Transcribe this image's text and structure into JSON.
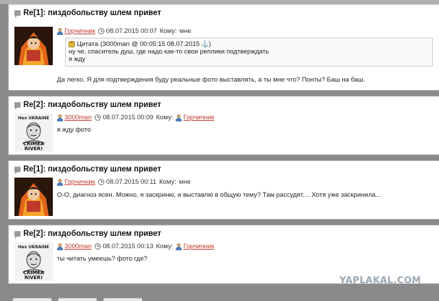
{
  "posts": [
    {
      "title": "Re[1]: пиздобольству шлем привет",
      "author": "Горчичник",
      "time": "08.07.2015 00:07",
      "to_label": "Кому:",
      "to": "мне",
      "quote": {
        "label": "Цитата",
        "source": "(3000man @ 00:05:15 08.07.2015",
        "close": ")",
        "lines": [
          "ну че, спаситель душ, где надо как-то свои реплики подтверждать",
          "я жду"
        ]
      },
      "text": "Да легко. Я для подтверждения буду реальные фото выставлять, а ты мне что? Понты? Баш на баш."
    },
    {
      "title": "Re[2]: пиздобольству шлем привет",
      "author": "3000man",
      "time": "08.07.2015 00:09",
      "to_label": "Кому:",
      "to": "Горчичник",
      "text": "я жду фото"
    },
    {
      "title": "Re[1]: пиздобольству шлем привет",
      "author": "Горчичник",
      "time": "08.07.2015 00:11",
      "to_label": "Кому:",
      "to": "мне",
      "text": "О-О, диагноз ясен. Можно, я заскриню, и выставлю в общую тему? Там рассудят.... Хотя уже заскринила..."
    },
    {
      "title": "Re[2]: пиздобольству шлем привет",
      "author": "3000man",
      "time": "08.07.2015 00:13",
      "to_label": "Кому:",
      "to": "Горчичник",
      "text": "ты читать умеешь? фото где?"
    }
  ],
  "avatar_text": {
    "line1": "Hex UKRAINE",
    "line2": "CRIMEA",
    "line3": "RIVER!"
  },
  "watermark": "YAPLAKAL.COM",
  "colors": {
    "link": "#c0392b",
    "page_bg": "#8a8a8a",
    "card_bg": "#ffffff",
    "watermark": "#9aa7b3"
  }
}
